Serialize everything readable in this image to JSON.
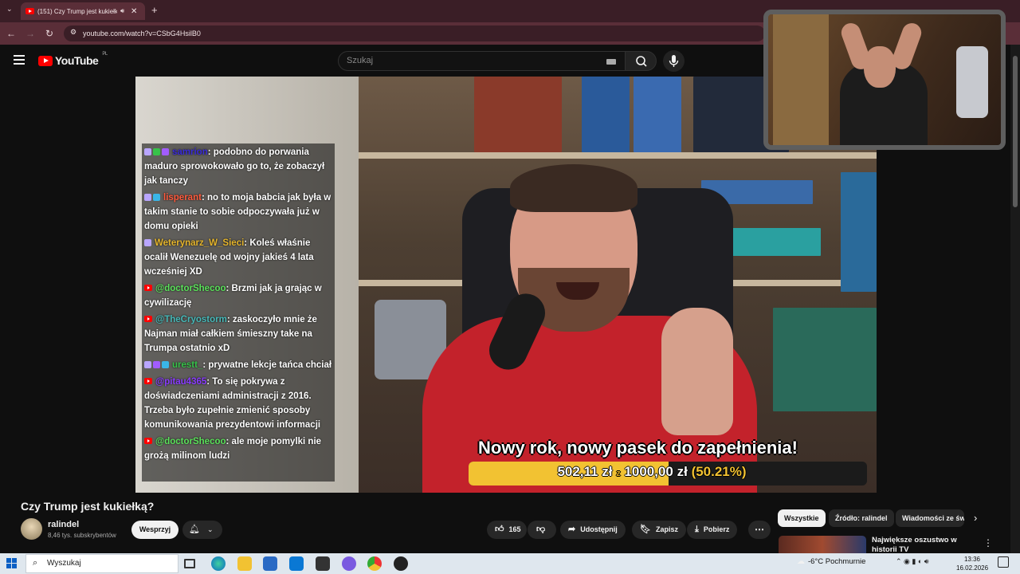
{
  "browser": {
    "tab_title": "(151) Czy Trump jest kukiełk",
    "url": "youtube.com/watch?v=CSbG4HsilB0"
  },
  "youtube": {
    "logo_text": "YouTube",
    "region": "PL",
    "search_placeholder": "Szukaj"
  },
  "chat": [
    {
      "user": "samrion",
      "user_color": "#3a2bd8",
      "text": ": podobno do porwania maduro sprowokowało go to, że zobaczył jak tanczy",
      "badges": [
        "#b9a6ff",
        "#37c24a",
        "#a25cff"
      ],
      "platform": "twitch"
    },
    {
      "user": "lisperant",
      "user_color": "#ff5a3c",
      "text": ": no to moja babcia jak była w takim stanie to sobie odpoczywała już w domu opieki",
      "badges": [
        "#b9a6ff",
        "#3ab6e8"
      ],
      "platform": "twitch"
    },
    {
      "user": "Weterynarz_W_Sieci",
      "user_color": "#e5b52c",
      "text": ": Koleś właśnie ocalił Wenezuelę od wojny jakieś 4 lata wcześniej XD",
      "badges": [
        "#b9a6ff"
      ],
      "platform": "twitch"
    },
    {
      "user": "@doctorShecoo",
      "user_color": "#5be15b",
      "text": ": Brzmi jak ja grając w cywilizację",
      "badges": [],
      "platform": "youtube"
    },
    {
      "user": "@TheCryostorm",
      "user_color": "#47b8b8",
      "text": ": zaskoczyło mnie że Najman miał całkiem śmieszny take na Trumpa ostatnio xD",
      "badges": [],
      "platform": "youtube"
    },
    {
      "user": "urestt_",
      "user_color": "#37c24a",
      "text": ": prywatne lekcje tańca chciał",
      "badges": [
        "#b9a6ff",
        "#a25cff",
        "#3ab6e8"
      ],
      "platform": "twitch"
    },
    {
      "user": "@pitau4365",
      "user_color": "#8a3cff",
      "text": ": To się pokrywa z doświadczeniami administracji z 2016. Trzeba było zupełnie zmienić sposoby komunikowania prezydentowi informacji",
      "badges": [],
      "platform": "youtube"
    },
    {
      "user": "@doctorShecoo",
      "user_color": "#5be15b",
      "text": ": ale moje pomylki nie grożą milinom ludzi",
      "badges": [],
      "platform": "youtube"
    }
  ],
  "overlay": {
    "title": "Nowy rok, nowy pasek do zapełnienia!",
    "current": "502,11 zł",
    "separator": "z",
    "goal": "1000,00 zł",
    "percent_text": "(50.21%)",
    "progress": 0.5021
  },
  "video": {
    "title": "Czy Trump jest kukiełką?",
    "channel": "ralindel",
    "subscribers": "8,46 tys. subskrybentów",
    "support_label": "Wesprzyj",
    "likes": "165",
    "share_label": "Udostępnij",
    "save_label": "Zapisz",
    "download_label": "Pobierz"
  },
  "sidebar": {
    "chips": [
      "Wszystkie",
      "Źródło: ralindel",
      "Wiadomości ze św"
    ],
    "rec_title": "Największe oszustwo w historii TV"
  },
  "taskbar": {
    "search_placeholder": "Wyszukaj",
    "weather": "-6°C  Pochmurnie",
    "time": "13:36",
    "date": "16.02.2026"
  }
}
